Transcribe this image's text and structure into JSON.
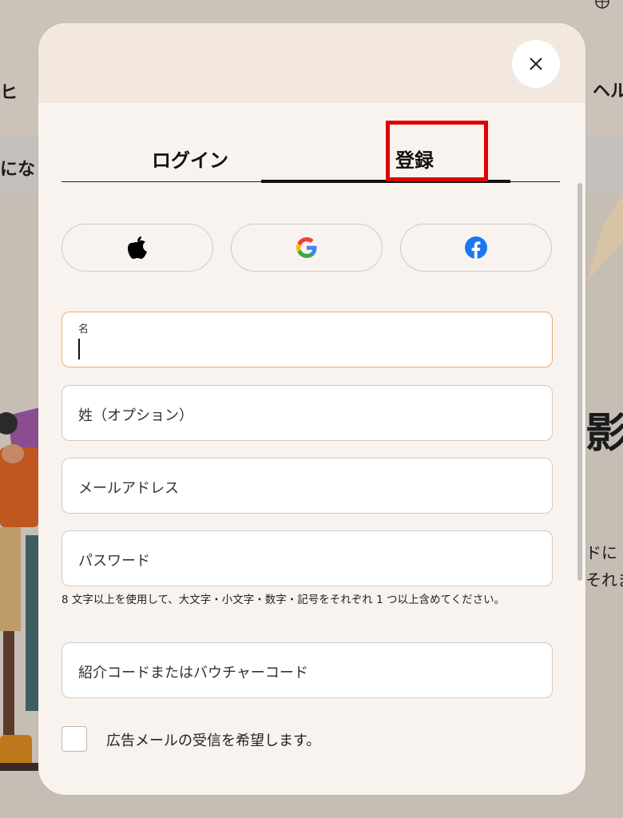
{
  "background": {
    "nav_fragment_left": "ヒ",
    "nav_fragment_right": "ヘル",
    "banner_fragment": "になり",
    "hero_heading_fragment": "影",
    "hero_text_line1": "ドに A",
    "hero_text_line2": "それま"
  },
  "modal": {
    "close_label": "×",
    "tabs": {
      "login": "ログイン",
      "register": "登録"
    },
    "social": {
      "apple_icon": "apple-icon",
      "google_icon": "google-icon",
      "facebook_icon": "facebook-icon"
    },
    "fields": {
      "first_name_label": "名",
      "last_name_placeholder": "姓（オプション）",
      "email_placeholder": "メールアドレス",
      "password_placeholder": "パスワード",
      "password_hint": "8 文字以上を使用して、大文字・小文字・数字・記号をそれぞれ 1 つ以上含めてください。",
      "referral_placeholder": "紹介コードまたはバウチャーコード"
    },
    "marketing_opt_in": {
      "label": "広告メールの受信を希望します。",
      "checked": false
    }
  },
  "colors": {
    "accent_highlight": "#e00000",
    "focus_border": "#f0a868",
    "facebook_blue": "#1877f2"
  }
}
